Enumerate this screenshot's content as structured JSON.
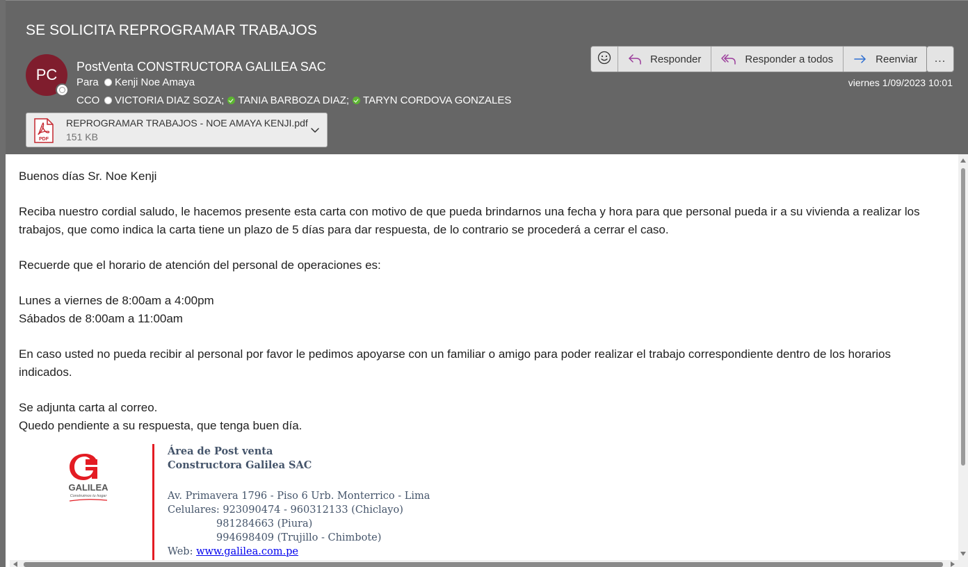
{
  "message": {
    "subject": "SE SOLICITA REPROGRAMAR TRABAJOS",
    "sender": {
      "initials": "PC",
      "name": "PostVenta CONSTRUCTORA GALILEA SAC"
    },
    "to_label": "Para",
    "to": [
      {
        "name": "Kenji Noe Amaya",
        "status": "offline"
      }
    ],
    "bcc_label": "CCO",
    "bcc": [
      {
        "name": "VICTORIA DIAZ SOZA;",
        "status": "offline"
      },
      {
        "name": "TANIA BARBOZA DIAZ;",
        "status": "available"
      },
      {
        "name": "TARYN CORDOVA GONZALES",
        "status": "available"
      }
    ],
    "date": "viernes 1/09/2023 10:01"
  },
  "actions": {
    "emoji_icon": "smiley-icon",
    "reply": "Responder",
    "reply_all": "Responder a todos",
    "forward": "Reenviar",
    "more": "..."
  },
  "attachment": {
    "name": "REPROGRAMAR TRABAJOS - NOE AMAYA KENJI.pdf",
    "size": "151 KB",
    "icon": "pdf-icon",
    "icon_label": "PDF"
  },
  "body": {
    "greeting": "Buenos días Sr. Noe Kenji",
    "p1": "Reciba nuestro cordial saludo, le hacemos presente esta carta con motivo de que pueda brindarnos una fecha y hora para que personal pueda ir a su vivienda a realizar los trabajos, que como indica la carta tiene un plazo de 5 días para dar respuesta, de lo contrario se procederá a cerrar el caso.",
    "p2": "Recuerde que el horario de atención del personal de operaciones es:",
    "schedule1": "Lunes a viernes de 8:00am a 4:00pm",
    "schedule2": "Sábados de 8:00am a 11:00am",
    "p3": "En caso usted no pueda recibir al personal por favor le pedimos apoyarse con un familiar o amigo para poder realizar el trabajo correspondiente dentro de los horarios indicados.",
    "closing1": "Se adjunta carta al correo.",
    "closing2": "Quedo pendiente a su respuesta, que tenga buen día."
  },
  "signature": {
    "logo_text": "GALILEA",
    "logo_tagline": "Construimos tu hogar",
    "dept": "Área de Post venta",
    "company": "Constructora Galilea SAC",
    "address": "Av. Primavera 1796 - Piso 6 Urb. Monterrico - Lima",
    "phones_label": "Celulares: 923090474 - 960312133 (Chiclayo)",
    "phone2": "981284663 (Piura)",
    "phone3": "994698409 (Trujillo - Chimbote)",
    "web_label": "Web: ",
    "web_link": "www.galilea.com.pe"
  },
  "colors": {
    "header_bg": "#666666",
    "avatar_bg": "#7f1d2d",
    "signature_bar": "#e31c23",
    "reply_icon": "#9b3c9b",
    "forward_icon": "#2e6fd1",
    "link": "#0000ee"
  }
}
